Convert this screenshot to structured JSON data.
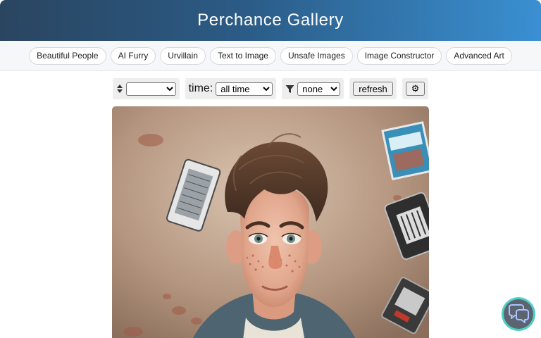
{
  "header": {
    "title": "Perchance Gallery"
  },
  "nav": {
    "items": [
      "Beautiful People",
      "AI Furry",
      "Urvillain",
      "Text to Image",
      "Unsafe Images",
      "Image Constructor",
      "Advanced Art"
    ]
  },
  "controls": {
    "sort": {
      "icon": "sort-icon",
      "selected": ""
    },
    "time": {
      "label": "time:",
      "selected": "all time"
    },
    "filter": {
      "icon": "filter-icon",
      "selected": "none"
    },
    "refresh_label": "refresh",
    "settings_icon": "gear-icon",
    "settings_label": "⚙"
  },
  "gallery": {
    "image": {
      "subject": "illustrated boy with messy brown hair and freckles, viewed from above, cassette tapes on floor"
    }
  },
  "chat": {
    "icon": "chat-bubbles-icon",
    "accent": "#4fd0c6"
  }
}
